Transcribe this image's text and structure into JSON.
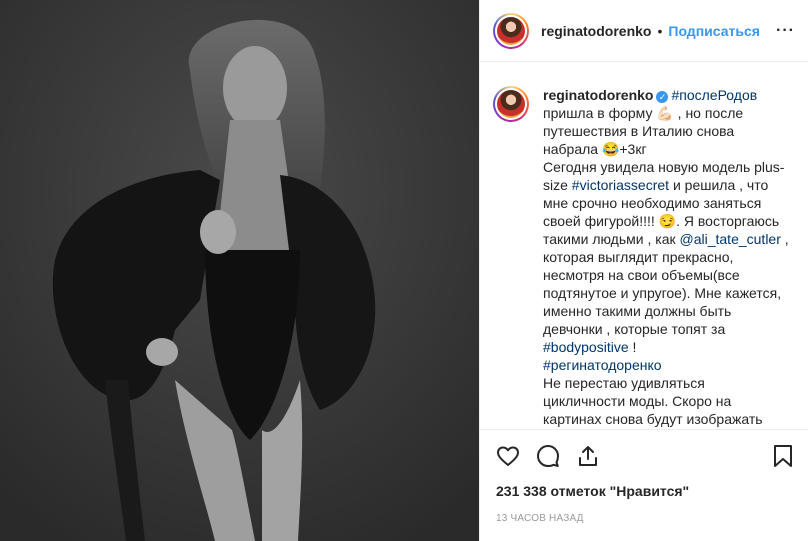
{
  "post": {
    "username": "reginatodorenko",
    "header_separator": "•",
    "follow_label": "Подписаться",
    "more_label": "···",
    "verified_mark": "✓"
  },
  "caption": {
    "username": "reginatodorenko",
    "segments": [
      {
        "type": "tag",
        "text": "#послеРодов"
      },
      {
        "type": "text",
        "text": " пришла в форму 💪🏻 , но после путешествия в Италию снова набрала 😂+3кг"
      },
      {
        "type": "br"
      },
      {
        "type": "text",
        "text": "Сегодня увидела новую модель plus-size "
      },
      {
        "type": "tag",
        "text": "#victoriassecret"
      },
      {
        "type": "text",
        "text": " и решила , что мне срочно необходимо заняться своей фигурой!!!! 😏. Я восторгаюсь такими людьми , как "
      },
      {
        "type": "tag",
        "text": "@ali_tate_cutler"
      },
      {
        "type": "text",
        "text": " , которая выглядит прекрасно, несмотря на свои объемы(все подтянутое и упругое). Мне кажется, именно такими должны быть девчонки , которые топят за "
      },
      {
        "type": "tag",
        "text": "#bodypositive"
      },
      {
        "type": "text",
        "text": " !"
      },
      {
        "type": "br"
      },
      {
        "type": "tag",
        "text": "#регинатодоренко"
      },
      {
        "type": "br"
      },
      {
        "type": "text",
        "text": "Не перестаю удивляться цикличности моды. Скоро на картинах снова будут изображать"
      }
    ]
  },
  "actions": {
    "like_icon": "heart-icon",
    "comment_icon": "comment-icon",
    "share_icon": "share-icon",
    "save_icon": "bookmark-icon"
  },
  "likes_text": "231 338 отметок \"Нравится\"",
  "timestamp": "13 ЧАСОВ НАЗАД",
  "colors": {
    "link": "#3897f0",
    "hashtag": "#003569",
    "text": "#262626",
    "muted": "#999999",
    "photo_bg": "#383838"
  }
}
